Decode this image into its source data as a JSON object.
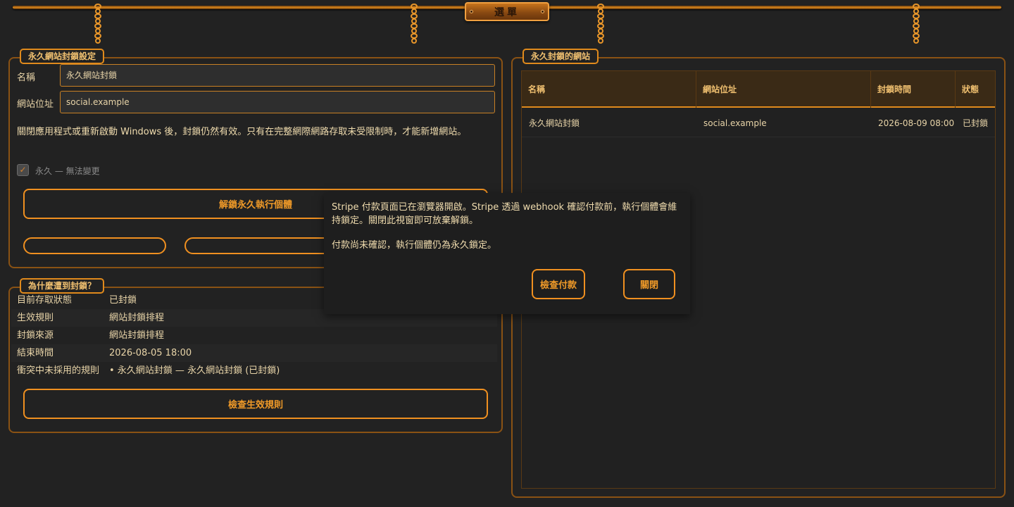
{
  "menu": {
    "label": "選單"
  },
  "settings": {
    "title": "永久網站封鎖設定",
    "name_label": "名稱",
    "name_value": "永久網站封鎖",
    "url_label": "網站位址",
    "url_value": "social.example",
    "note": "關閉應用程式或重新啟動 Windows 後，封鎖仍然有效。只有在完整網際網路存取未受限制時，才能新增網站。",
    "permanent_checkbox_label": "永久 — 無法變更",
    "permanent_checked": true,
    "unlock_button": "解鎖永久執行個體"
  },
  "why": {
    "title": "為什麼遭到封鎖？",
    "rows": [
      {
        "key": "目前存取狀態",
        "value": "已封鎖"
      },
      {
        "key": "生效規則",
        "value": "網站封鎖排程"
      },
      {
        "key": "封鎖來源",
        "value": "網站封鎖排程"
      },
      {
        "key": "結束時間",
        "value": "2026-08-05 18:00"
      },
      {
        "key": "衝突中未採用的規則",
        "value": "• 永久網站封鎖 — 永久網站封鎖 (已封鎖)"
      }
    ],
    "check_button": "檢查生效規則"
  },
  "blocked_sites": {
    "title": "永久封鎖的網站",
    "columns": [
      "名稱",
      "網站位址",
      "封鎖時間",
      "狀態"
    ],
    "rows": [
      {
        "name": "永久網站封鎖",
        "url": "social.example",
        "time": "2026-08-09 08:00",
        "status": "已封鎖"
      }
    ]
  },
  "popup": {
    "message": "Stripe 付款頁面已在瀏覽器開啟。Stripe 透過 webhook 確認付款前，執行個體會維持鎖定。關閉此視窗即可放棄解鎖。",
    "status": "付款尚未確認，執行個體仍為永久鎖定。",
    "check_payment_button": "檢查付款",
    "close_button": "關閉"
  },
  "colors": {
    "accent": "#f09020",
    "background": "#222222",
    "text": "#e8d4a8"
  }
}
